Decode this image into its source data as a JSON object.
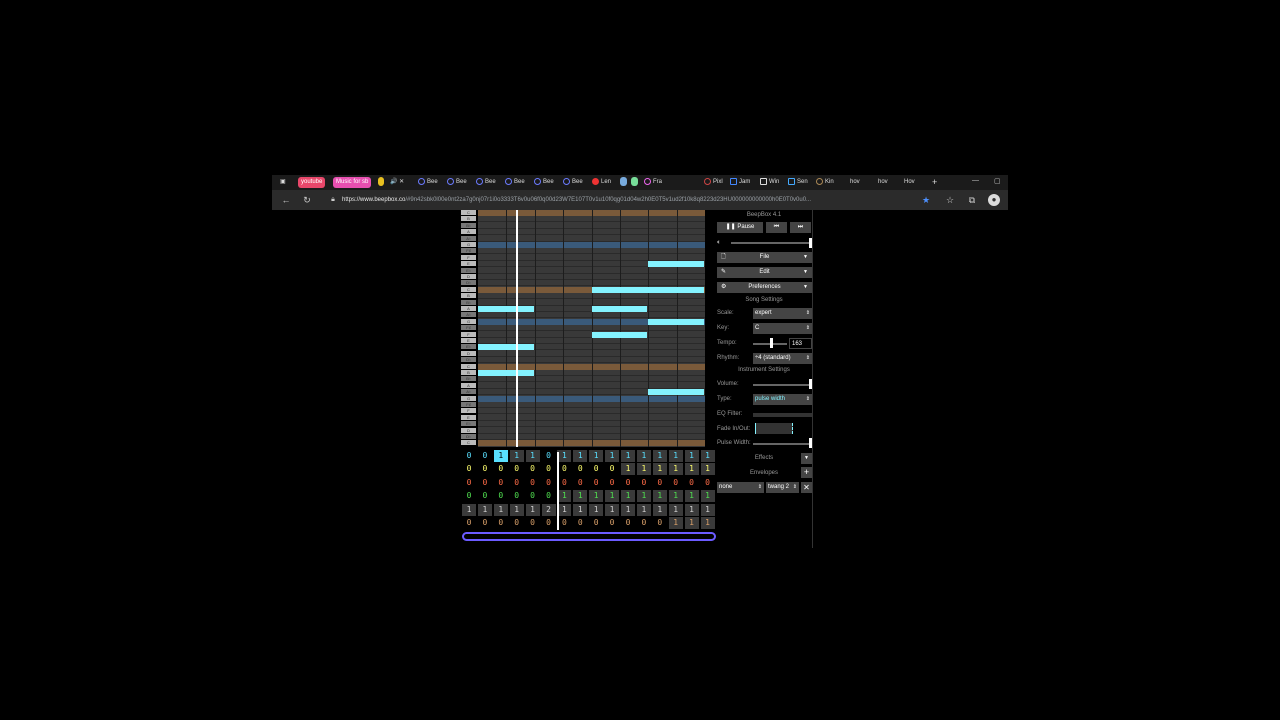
{
  "browser": {
    "tabs": [
      {
        "label": "youtube",
        "color": "#e8476a",
        "pill": true
      },
      {
        "label": "Music for sb",
        "color": "#e84fb0",
        "pill": true
      },
      {
        "label": "Bee"
      },
      {
        "label": "Bee"
      },
      {
        "label": "Bee"
      },
      {
        "label": "Bee"
      },
      {
        "label": "Bee"
      },
      {
        "label": "Bee"
      },
      {
        "label": "Len"
      },
      {
        "label": "Fra"
      },
      {
        "label": "Pixl"
      },
      {
        "label": "Jam"
      },
      {
        "label": "Win"
      },
      {
        "label": "Sen"
      },
      {
        "label": "Kin"
      },
      {
        "label": "hov"
      },
      {
        "label": "hov"
      },
      {
        "label": "Hov"
      }
    ],
    "url_host": "https://www.beepbox.co",
    "url_rest": "/#9n42sbk0l00e0nt2za7g0nj07r1i0o3333T6v0u06f0q00d23W7E107T0v1u10f0qg01d04w2h0E0T5v1ud2f10k8q8223d23HU000000000000h0E0T0v0u0..."
  },
  "app": {
    "version": "BeepBox 4.1",
    "pause_label": "Pause",
    "file_label": "File",
    "edit_label": "Edit",
    "preferences_label": "Preferences",
    "song_settings": "Song Settings",
    "scale_label": "Scale:",
    "scale_value": "expert",
    "key_label": "Key:",
    "key_value": "C",
    "tempo_label": "Tempo:",
    "tempo_value": "163",
    "rhythm_label": "Rhythm:",
    "rhythm_value": "÷4 (standard)",
    "instrument_settings": "Instrument Settings",
    "volume_label": "Volume:",
    "type_label": "Type:",
    "type_value": "pulse width",
    "eq_label": "EQ Filter:",
    "fade_label": "Fade In/Out:",
    "pulse_label": "Pulse Width:",
    "effects_label": "Effects",
    "envelopes_label": "Envelopes",
    "envelope_target": "none",
    "envelope_shape": "twang 2"
  },
  "piano_keys": [
    "C",
    "B",
    "B♭",
    "A",
    "A♭",
    "G",
    "F♯",
    "F",
    "E",
    "E♭",
    "D",
    "D♭",
    "C",
    "B",
    "B♭",
    "A",
    "A♭",
    "G",
    "F♯",
    "F",
    "E",
    "E♭",
    "D",
    "D♭",
    "C",
    "B",
    "B♭",
    "A",
    "A♭",
    "G",
    "F♯",
    "F",
    "E",
    "E♭",
    "D",
    "D♭",
    "C"
  ],
  "pattern_grid": {
    "rows": [
      {
        "color": "#59e0ff",
        "values": [
          "0",
          "0",
          "1",
          "1",
          "1",
          "0",
          "1",
          "1",
          "1",
          "1",
          "1",
          "1",
          "1",
          "1",
          "1",
          "1"
        ]
      },
      {
        "color": "#ffff6e",
        "values": [
          "0",
          "0",
          "0",
          "0",
          "0",
          "0",
          "0",
          "0",
          "0",
          "0",
          "1",
          "1",
          "1",
          "1",
          "1",
          "1"
        ]
      },
      {
        "color": "#ff6c47",
        "values": [
          "0",
          "0",
          "0",
          "0",
          "0",
          "0",
          "0",
          "0",
          "0",
          "0",
          "0",
          "0",
          "0",
          "0",
          "0",
          "0"
        ]
      },
      {
        "color": "#50e050",
        "values": [
          "0",
          "0",
          "0",
          "0",
          "0",
          "0",
          "1",
          "1",
          "1",
          "1",
          "1",
          "1",
          "1",
          "1",
          "1",
          "1"
        ]
      },
      {
        "color": "#d0d0d0",
        "values": [
          "1",
          "1",
          "1",
          "1",
          "1",
          "2",
          "1",
          "1",
          "1",
          "1",
          "1",
          "1",
          "1",
          "1",
          "1",
          "1"
        ]
      },
      {
        "color": "#d9a06a",
        "values": [
          "0",
          "0",
          "0",
          "0",
          "0",
          "0",
          "0",
          "0",
          "0",
          "0",
          "0",
          "0",
          "0",
          "1",
          "1",
          "1"
        ]
      }
    ]
  },
  "colors": {
    "note": "#84f3ff",
    "accent": "#6b5bff",
    "c_row": "#7a5a3a",
    "g_row": "#3a5a7a"
  }
}
